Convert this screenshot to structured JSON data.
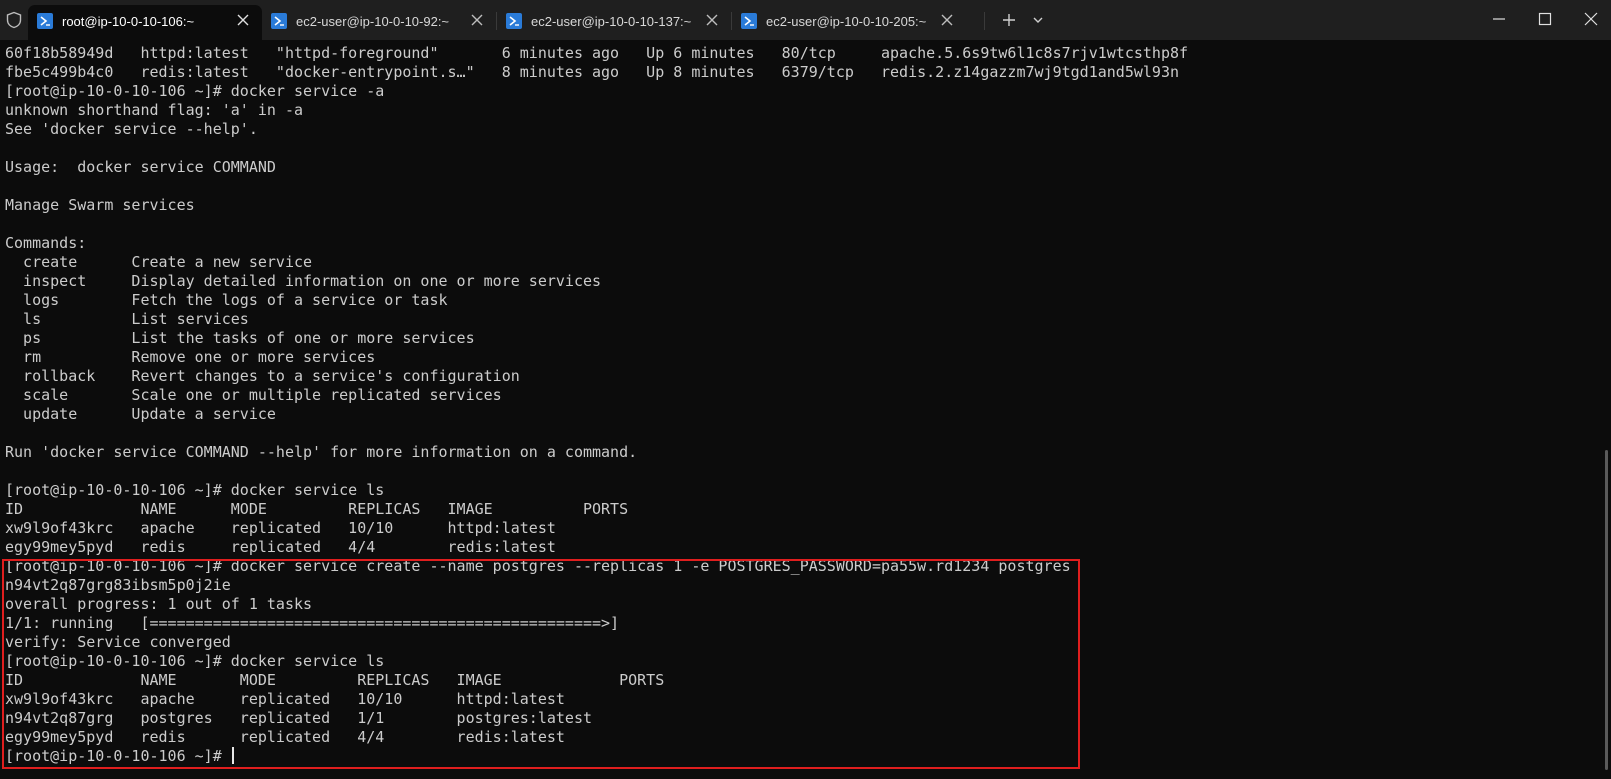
{
  "tabs": [
    {
      "label": "root@ip-10-0-10-106:~",
      "active": true
    },
    {
      "label": "ec2-user@ip-10-0-10-92:~",
      "active": false
    },
    {
      "label": "ec2-user@ip-10-0-10-137:~",
      "active": false
    },
    {
      "label": "ec2-user@ip-10-0-10-205:~",
      "active": false
    }
  ],
  "colors": {
    "background": "#0c0c0c",
    "titlebar": "#1f1f1f",
    "text": "#cccccc",
    "highlight_border": "#e01e1e",
    "tab_icon": "#2a7bd8"
  },
  "icons": {
    "shield": "shield-icon",
    "tab": "powershell-icon",
    "close": "close-icon",
    "new_tab": "plus-icon",
    "dropdown": "chevron-down-icon",
    "minimize": "minimize-icon",
    "maximize": "maximize-icon",
    "window_close": "window-close-icon"
  },
  "terminal": {
    "lines": [
      "60f18b58949d   httpd:latest   \"httpd-foreground\"       6 minutes ago   Up 6 minutes   80/tcp     apache.5.6s9tw6l1c8s7rjv1wtcsthp8f",
      "fbe5c499b4c0   redis:latest   \"docker-entrypoint.s…\"   8 minutes ago   Up 8 minutes   6379/tcp   redis.2.z14gazzm7wj9tgd1and5wl93n",
      "[root@ip-10-0-10-106 ~]# docker service -a",
      "unknown shorthand flag: 'a' in -a",
      "See 'docker service --help'.",
      "",
      "Usage:  docker service COMMAND",
      "",
      "Manage Swarm services",
      "",
      "Commands:",
      "  create      Create a new service",
      "  inspect     Display detailed information on one or more services",
      "  logs        Fetch the logs of a service or task",
      "  ls          List services",
      "  ps          List the tasks of one or more services",
      "  rm          Remove one or more services",
      "  rollback    Revert changes to a service's configuration",
      "  scale       Scale one or multiple replicated services",
      "  update      Update a service",
      "",
      "Run 'docker service COMMAND --help' for more information on a command.",
      "",
      "[root@ip-10-0-10-106 ~]# docker service ls",
      "ID             NAME      MODE         REPLICAS   IMAGE          PORTS",
      "xw9l9of43krc   apache    replicated   10/10      httpd:latest",
      "egy99mey5pyd   redis     replicated   4/4        redis:latest",
      "[root@ip-10-0-10-106 ~]# docker service create --name postgres --replicas 1 -e POSTGRES_PASSWORD=pa55w.rd1234 postgres",
      "n94vt2q87grg83ibsm5p0j2ie",
      "overall progress: 1 out of 1 tasks",
      "1/1: running   [==================================================>]",
      "verify: Service converged",
      "[root@ip-10-0-10-106 ~]# docker service ls",
      "ID             NAME       MODE         REPLICAS   IMAGE             PORTS",
      "xw9l9of43krc   apache     replicated   10/10      httpd:latest",
      "n94vt2q87grg   postgres   replicated   1/1        postgres:latest",
      "egy99mey5pyd   redis      replicated   4/4        redis:latest",
      "[root@ip-10-0-10-106 ~]# "
    ]
  }
}
